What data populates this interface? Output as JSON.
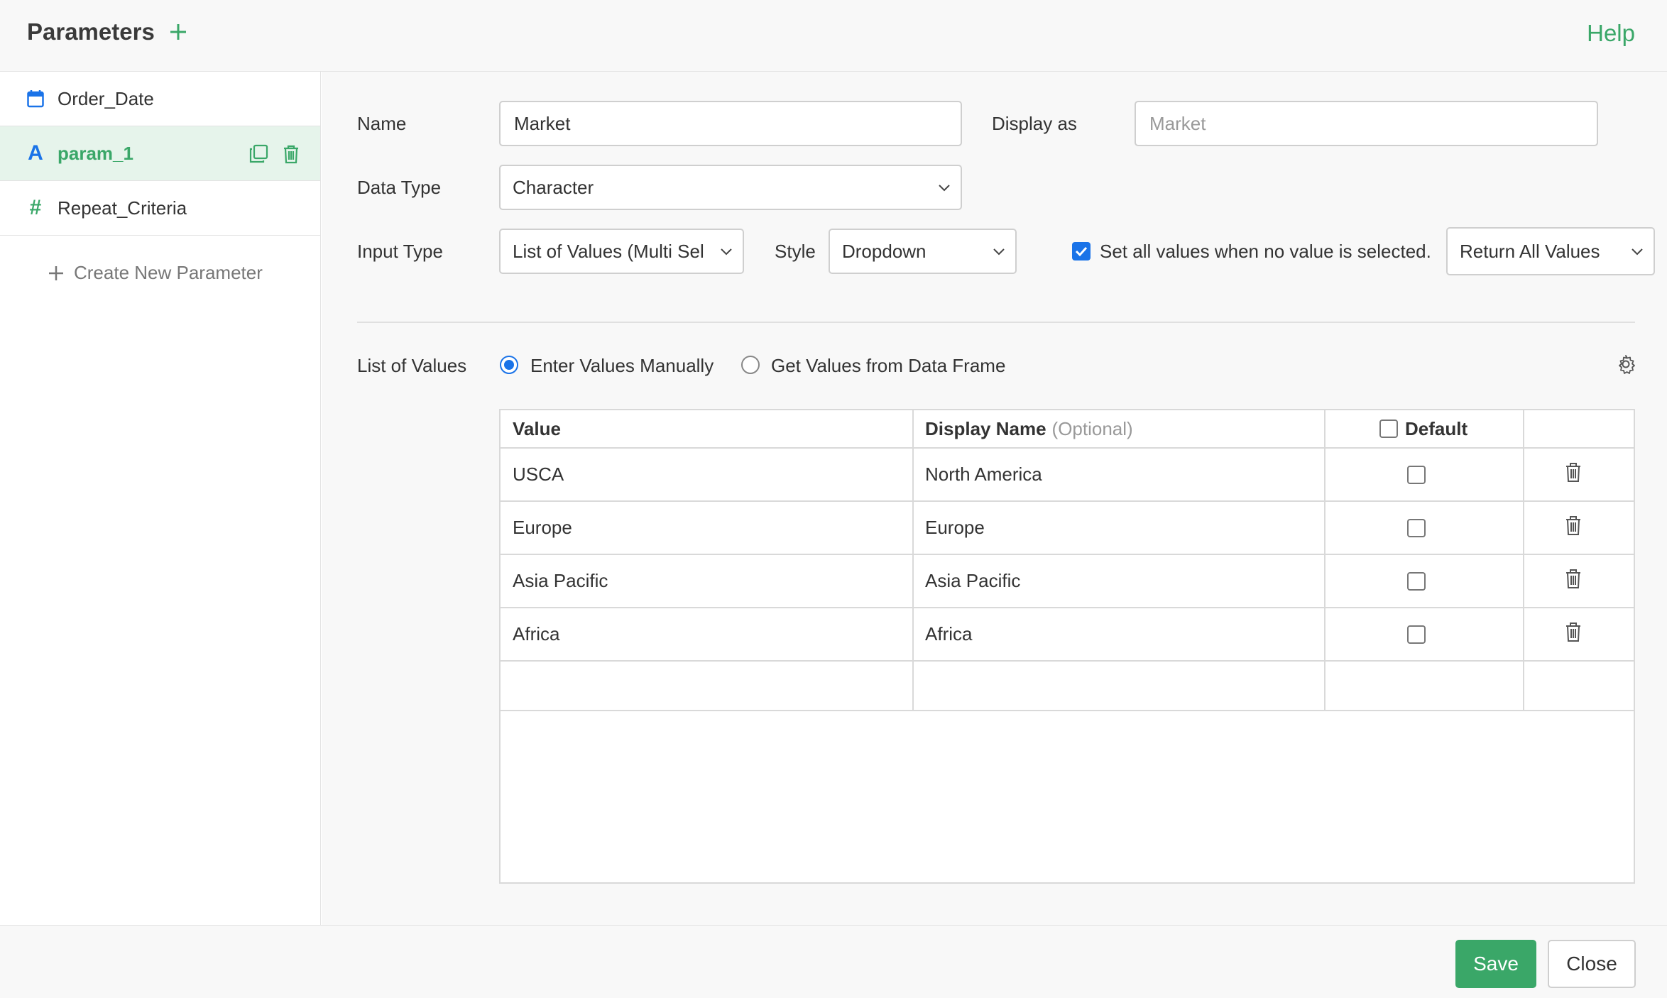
{
  "header": {
    "title": "Parameters",
    "help_label": "Help"
  },
  "sidebar": {
    "items": [
      {
        "label": "Order_Date",
        "icon": "calendar-icon",
        "active": false
      },
      {
        "label": "param_1",
        "icon": "character-a-icon",
        "icon_glyph": "A",
        "active": true
      },
      {
        "label": "Repeat_Criteria",
        "icon": "hash-icon",
        "icon_glyph": "#",
        "active": false
      }
    ],
    "create_new_label": "Create New Parameter"
  },
  "form": {
    "name_label": "Name",
    "name_value": "Market",
    "display_as_label": "Display as",
    "display_as_placeholder": "Market",
    "data_type_label": "Data Type",
    "data_type_value": "Character",
    "input_type_label": "Input Type",
    "input_type_value": "List of Values (Multi Sel",
    "style_label": "Style",
    "style_value": "Dropdown",
    "set_all_label": "Set all values when no value is selected.",
    "set_all_checked": true,
    "return_value": "Return All Values"
  },
  "list_of_values": {
    "label": "List of Values",
    "option_manual": "Enter Values Manually",
    "option_frame": "Get Values from Data Frame",
    "selected": "manual"
  },
  "table": {
    "headers": {
      "value": "Value",
      "display_name": "Display Name",
      "display_name_hint": "(Optional)",
      "default": "Default"
    },
    "rows": [
      {
        "value": "USCA",
        "display_name": "North America"
      },
      {
        "value": "Europe",
        "display_name": "Europe"
      },
      {
        "value": "Asia Pacific",
        "display_name": "Asia Pacific"
      },
      {
        "value": "Africa",
        "display_name": "Africa"
      }
    ]
  },
  "footer": {
    "save_label": "Save",
    "close_label": "Close"
  },
  "colors": {
    "accent": "#3aa768",
    "active_bg": "#e6f4eb",
    "blue": "#1a73e8"
  }
}
